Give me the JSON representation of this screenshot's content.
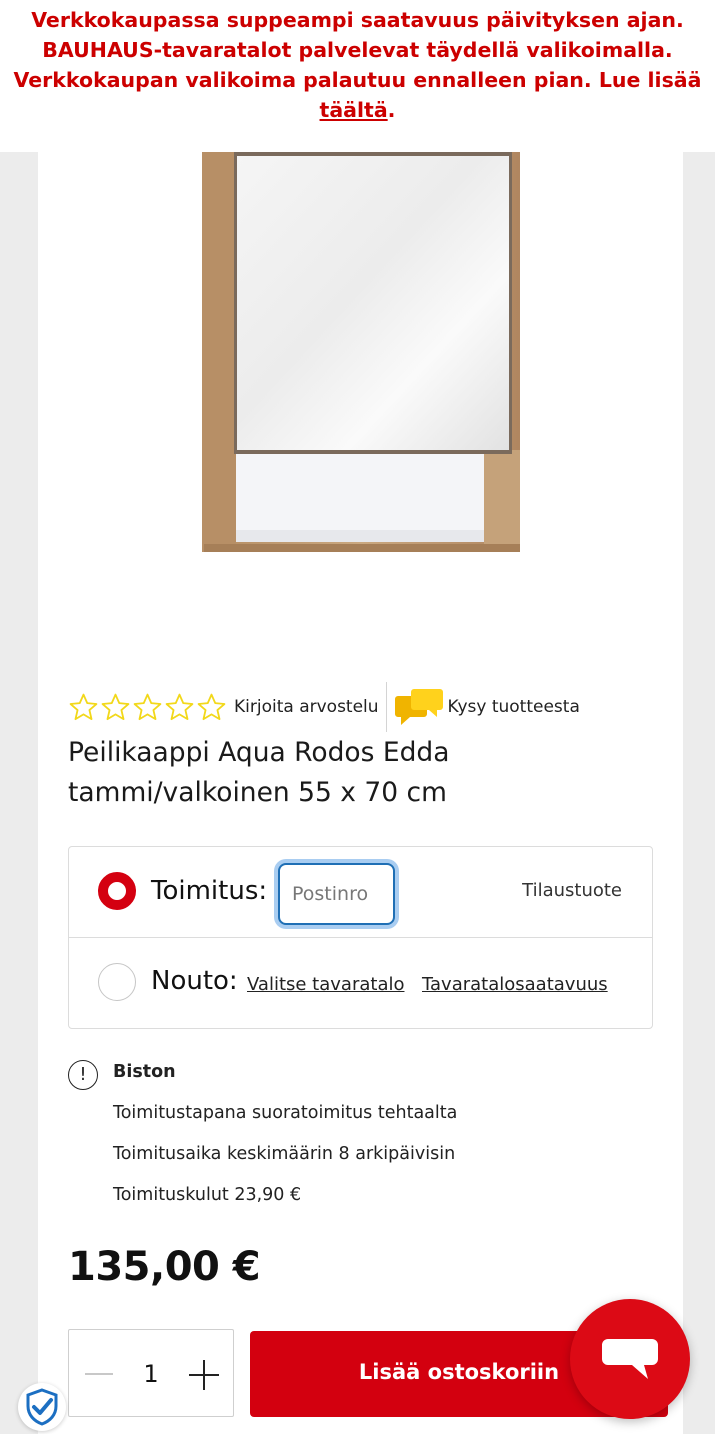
{
  "notice": {
    "text": "Verkkokaupassa suppeampi saatavuus päivityksen ajan. BAUHAUS-tavaratalot palvelevat täydellä valikoimalla. Verkkokaupan valikoima palautuu ennalleen pian. Lue lisää ",
    "link": "täältä",
    "end": ".",
    "color": "#cc0000"
  },
  "product": {
    "title": "Peilikaappi Aqua Rodos Edda tammi/valkoinen 55 x 70 cm",
    "rating_stars": 0,
    "rating_max": 5,
    "review_link": "Kirjoita arvostelu",
    "ask_link": "Kysy tuotteesta"
  },
  "delivery": {
    "shipping_label": "Toimitus:",
    "postal_placeholder": "Postinro",
    "order_type": "Tilaustuote",
    "pickup_label": "Nouto:",
    "choose_store": "Valitse tavaratalo",
    "store_availability": "Tavaratalosaatavuus"
  },
  "info": {
    "supplier": "Biston",
    "lines": [
      "Toimitustapana suoratoimitus tehtaalta",
      "Toimitusaika keskimäärin 8 arkipäivisin",
      "Toimituskulut 23,90 €"
    ]
  },
  "price": "135,00 €",
  "cart": {
    "quantity": "1",
    "add_label": "Lisää ostoskoriin"
  },
  "colors": {
    "brand_red": "#d3000f",
    "star_yellow": "#f2d81a",
    "focus_blue": "#a9cdf1"
  }
}
